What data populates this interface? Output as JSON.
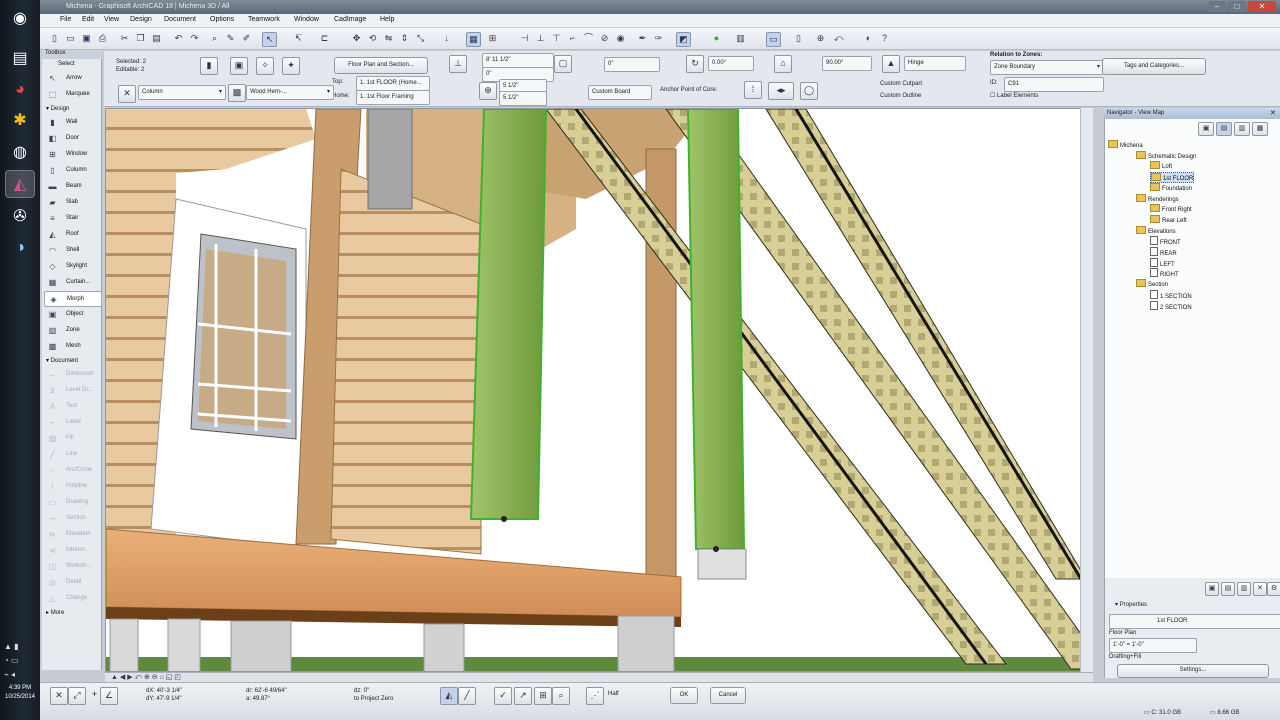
{
  "taskbar": {
    "apps": [
      "start-orb",
      "explorer",
      "chrome",
      "settings",
      "disk",
      "archicad",
      "media",
      "steam"
    ],
    "clock": {
      "time": "4:39 PM",
      "date": "10/25/2014"
    }
  },
  "window": {
    "title": "Michena - Graphisoft ArchiCAD 18 | Michena 3D / All",
    "controls": [
      "–",
      "□",
      "✕"
    ]
  },
  "menubar": [
    "File",
    "Edit",
    "View",
    "Design",
    "Document",
    "Options",
    "Teamwork",
    "Window",
    "CadImage",
    "Help"
  ],
  "toolbox": {
    "title": "Toolbox",
    "select_header": "Select",
    "top_tools": [
      "Arrow",
      "Marquee"
    ],
    "design_header": "Design",
    "design_tools": [
      "Wall",
      "Door",
      "Window",
      "Column",
      "Beam",
      "Slab",
      "Stair",
      "Roof",
      "Shell",
      "Skylight",
      "Curtain...",
      "Morph",
      "Object",
      "Zone",
      "Mesh"
    ],
    "selected_tool": "Morph",
    "document_header": "Document",
    "document_tools": [
      "Dimension",
      "Level Di...",
      "Text",
      "Label",
      "Fill",
      "Line",
      "Arc/Circle",
      "Polyline",
      "Drawing",
      "Section",
      "Elevation",
      "Interior...",
      "Worksh...",
      "Detail",
      "Change"
    ],
    "more_label": "More"
  },
  "infobox": {
    "selected_label": "Selected: 2",
    "editable_label": "Editable: 2",
    "tool_name": "Column",
    "material": "Wood Hem-...",
    "floor_button": "Floor Plan and Section...",
    "top_label": "Top:",
    "top_value": "1. 1st FLOOR (Home...",
    "home_label": "Home:",
    "home_value": "1. 1st Floor Framing",
    "height_value": "8' 11 1/2\"",
    "base_value": "0\"",
    "width_value": "5 1/2\"",
    "depth_value": "5 1/2\"",
    "offset_value": "0\"",
    "angle_value": "0.00°",
    "anchor_label": "Anchor Point of Core:",
    "cover_label": "Custom Board",
    "relation_label": "Relation to Zones:",
    "relation_value": "Zone Boundary",
    "tags_button": "Tags and Categories...",
    "id_label": "ID:",
    "id_value": "C91",
    "label_elements": "Label Elements",
    "cutline_a": "Custom Cutpart",
    "cutline_b": "Custom Outline",
    "angle2_value": "90.00°",
    "proj_value": "Hinge"
  },
  "navigator": {
    "title": "Navigator - View Map",
    "tree": [
      {
        "label": "Michena",
        "level": 0,
        "type": "folder"
      },
      {
        "label": "Schematic Design",
        "level": 1,
        "type": "folder"
      },
      {
        "label": "Loft",
        "level": 2,
        "type": "folder"
      },
      {
        "label": "1st FLOOR",
        "level": 2,
        "type": "folder",
        "highlight": true
      },
      {
        "label": "Foundation",
        "level": 2,
        "type": "folder"
      },
      {
        "label": "Renderings",
        "level": 1,
        "type": "folder"
      },
      {
        "label": "Front Right",
        "level": 2,
        "type": "view"
      },
      {
        "label": "Rear Left",
        "level": 2,
        "type": "view"
      },
      {
        "label": "Elevations",
        "level": 1,
        "type": "folder"
      },
      {
        "label": "FRONT",
        "level": 2,
        "type": "page"
      },
      {
        "label": "REAR",
        "level": 2,
        "type": "page"
      },
      {
        "label": "LEFT",
        "level": 2,
        "type": "page"
      },
      {
        "label": "RIGHT",
        "level": 2,
        "type": "page"
      },
      {
        "label": "Section",
        "level": 1,
        "type": "folder"
      },
      {
        "label": "1 SECTION",
        "level": 2,
        "type": "page"
      },
      {
        "label": "2 SECTION",
        "level": 2,
        "type": "page"
      }
    ],
    "properties_label": "Properties",
    "prop_value": "1st FLOOR",
    "floor_plan_label": "Floor Plan",
    "scale_a": "1'-0\"",
    "scale_b": "1'-0\"",
    "drafting_label": "Drafting+Fill",
    "settings_button": "Settings..."
  },
  "status": {
    "coord_dx": "dX: 40'-3 1/4\"",
    "coord_dy": "dY: 47'-9 1/4\"",
    "coord_r": "dr: 62'-6 49/64\"",
    "coord_a": "a: 49.87°",
    "z_value": "dz: 0\"",
    "ref_value": "to Project Zero",
    "snap_label": "Half",
    "ok_button": "OK",
    "cancel_button": "Cancel",
    "disk_c": "C: 31.0 GB",
    "ram": "8.66 GB"
  }
}
